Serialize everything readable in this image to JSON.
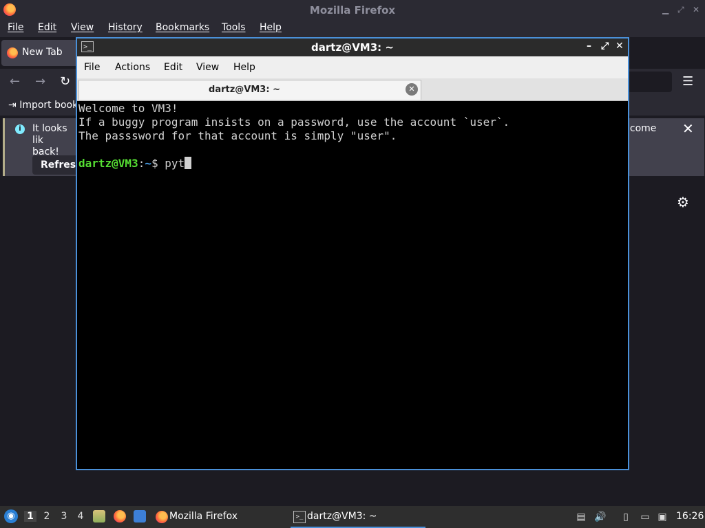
{
  "firefox": {
    "window_title": "Mozilla Firefox",
    "menu": [
      "File",
      "Edit",
      "View",
      "History",
      "Bookmarks",
      "Tools",
      "Help"
    ],
    "tab_label": "New Tab",
    "import_bookmarks": "Import book",
    "notification": {
      "text_start": "It looks lik",
      "text_start_line2": "back!",
      "text_end": "lcome",
      "refresh_button": "Refresh"
    }
  },
  "terminal": {
    "window_title": "dartz@VM3: ~",
    "menu": [
      "File",
      "Actions",
      "Edit",
      "View",
      "Help"
    ],
    "tab_label": "dartz@VM3: ~",
    "output_lines": [
      "Welcome to VM3!",
      "If a buggy program insists on a password, use the account `user`.",
      "The passsword for that account is simply \"user\"."
    ],
    "prompt": {
      "user_host": "dartz@VM3",
      "separator": ":",
      "path": "~",
      "symbol": "$ ",
      "input": "pyt"
    }
  },
  "taskbar": {
    "workspaces": [
      "1",
      "2",
      "3",
      "4"
    ],
    "active_workspace": "1",
    "tasks": [
      {
        "label": "Mozilla Firefox",
        "icon": "firefox-icon"
      },
      {
        "label": "dartz@VM3: ~",
        "icon": "terminal-icon"
      }
    ],
    "clock": "16:26"
  }
}
